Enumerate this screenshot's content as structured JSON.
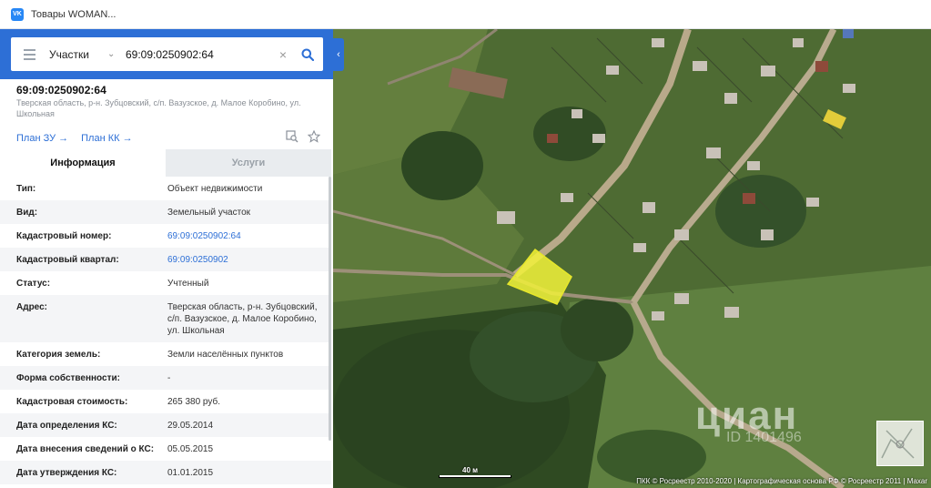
{
  "browser": {
    "tab_title": "Товары WOMAN...",
    "site_icon": "vk-icon"
  },
  "search": {
    "type_label": "Участки",
    "value": "69:09:0250902:64"
  },
  "object": {
    "title": "69:09:0250902:64",
    "address": "Тверская область, р-н. Зубцовский, с/п. Вазузское, д. Малое Коробино, ул. Школьная",
    "plan_zu": "План ЗУ →",
    "plan_kk": "План КК →"
  },
  "tabs": {
    "info": "Информация",
    "services": "Услуги"
  },
  "properties": [
    {
      "key": "Тип:",
      "value": "Объект недвижимости"
    },
    {
      "key": "Вид:",
      "value": "Земельный участок"
    },
    {
      "key": "Кадастровый номер:",
      "value": "69:09:0250902:64"
    },
    {
      "key": "Кадастровый квартал:",
      "value": "69:09:0250902"
    },
    {
      "key": "Статус:",
      "value": "Учтенный"
    },
    {
      "key": "Адрес:",
      "value": "Тверская область, р-н. Зубцовский, с/п. Вазузское, д. Малое Коробино, ул. Школьная"
    },
    {
      "key": "Категория земель:",
      "value": "Земли населённых пунктов"
    },
    {
      "key": "Форма собственности:",
      "value": "-"
    },
    {
      "key": "Кадастровая стоимость:",
      "value": "265 380 руб."
    },
    {
      "key": "Дата определения КС:",
      "value": "29.05.2014"
    },
    {
      "key": "Дата внесения сведений о КС:",
      "value": "05.05.2015"
    },
    {
      "key": "Дата утверждения КС:",
      "value": "01.01.2015"
    }
  ],
  "map": {
    "scale_label": "40 м",
    "attribution": "ПКК © Росреестр 2010-2020 | Картографическая основа РФ © Росреестр 2011 | Maxar",
    "watermark": "циан",
    "watermark_sub": "ID 1401496",
    "parcel_color": "#f2f23a"
  },
  "colors": {
    "accent": "#2d6fd6"
  }
}
